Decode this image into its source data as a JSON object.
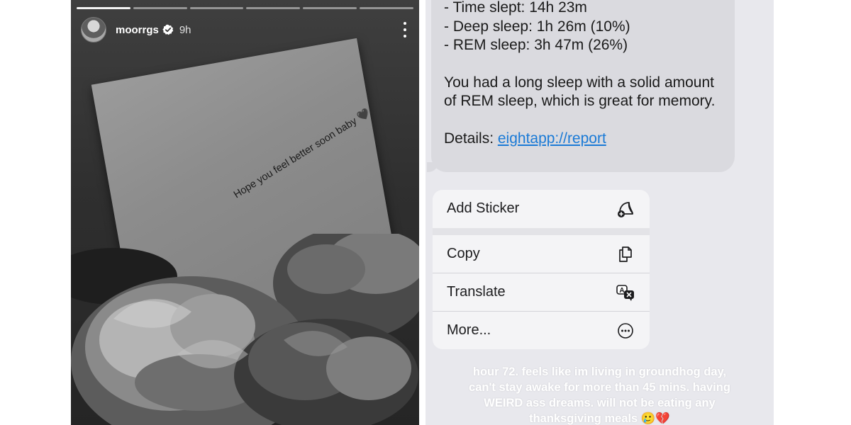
{
  "story": {
    "username": "moorrgs",
    "time": "9h",
    "card_text": "Hope you feel better soon baby 🖤",
    "progress_segments": 6,
    "progress_completed": 1
  },
  "messages": {
    "sleep_lines": [
      "- Time slept: 14h 23m",
      "- Deep sleep: 1h 26m (10%)",
      "- REM sleep: 3h 47m (26%)"
    ],
    "summary": "You had a long sleep with a solid amount of REM sleep, which is great for memory.",
    "details_label": "Details: ",
    "details_link": "eightapp://report"
  },
  "menu": {
    "items": [
      {
        "label": "Add Sticker",
        "icon": "sticker-add-icon"
      },
      {
        "label": "Copy",
        "icon": "copy-icon"
      },
      {
        "label": "Translate",
        "icon": "translate-icon"
      },
      {
        "label": "More...",
        "icon": "ellipsis-circle-icon"
      }
    ]
  },
  "caption": "hour 72. feels like im living in groundhog day, can't stay awake for more than 45 mins. having WEIRD ass dreams. will not be eating any thanksgiving meals 🥲💔",
  "colors": {
    "link": "#1a7ad6",
    "bubble": "#dadadf",
    "menu": "#f4f4f6"
  }
}
